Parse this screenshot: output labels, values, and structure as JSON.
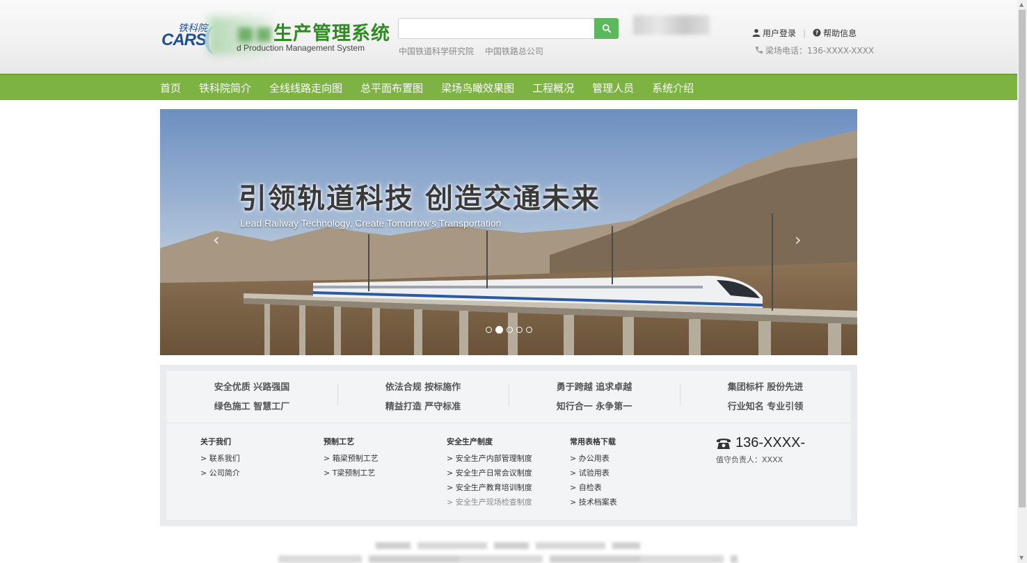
{
  "header": {
    "logo_cn": "铁科院",
    "logo_en": "CARS",
    "title": "生产管理系统",
    "subtitle": "d Production Management System",
    "search_placeholder": "",
    "sub_links": [
      "中国铁道科学研究院",
      "中国铁路总公司"
    ],
    "login": "用户登录",
    "help": "帮助信息",
    "phone": "梁场电话：136-XXXX-XXXX"
  },
  "nav": [
    "首页",
    "铁科院简介",
    "全线线路走向图",
    "总平面布置图",
    "梁场鸟瞰效果图",
    "工程概况",
    "管理人员",
    "系统介绍"
  ],
  "banner": {
    "title": "引领轨道科技  创造交通未来",
    "subtitle": "Lead Railway Technology, Create Tomorrow's Transportation",
    "prev": "‹",
    "next": "›",
    "slide_count": 5,
    "active_slide": 2
  },
  "slogans": [
    [
      "安全优质  兴路强国",
      "绿色施工  智慧工厂"
    ],
    [
      "依法合规  按标施作",
      "精益打造  严守标准"
    ],
    [
      "勇于跨越  追求卓越",
      "知行合一  永争第一"
    ],
    [
      "集团标杆  股份先进",
      "行业知名  专业引领"
    ]
  ],
  "footer_cols": [
    {
      "title": "关于我们",
      "items": [
        "> 联系我们",
        "> 公司简介"
      ]
    },
    {
      "title": "预制工艺",
      "items": [
        "> 箱梁预制工艺",
        "> T梁预制工艺"
      ]
    },
    {
      "title": "安全生产制度",
      "items": [
        "> 安全生产内部管理制度",
        "> 安全生产日常会议制度",
        "> 安全生产教育培训制度",
        "> 安全生产现场检查制度"
      ]
    },
    {
      "title": "常用表格下载",
      "items": [
        "> 办公用表",
        "> 试验用表",
        "> 自检表",
        "> 技术档案表"
      ]
    }
  ],
  "contact": {
    "number": "136-XXXX-",
    "person": "值守负责人：XXXX"
  },
  "colors": {
    "nav_green": "#7cb342",
    "title_green": "#2e8b22",
    "search_green": "#5cb85c"
  }
}
